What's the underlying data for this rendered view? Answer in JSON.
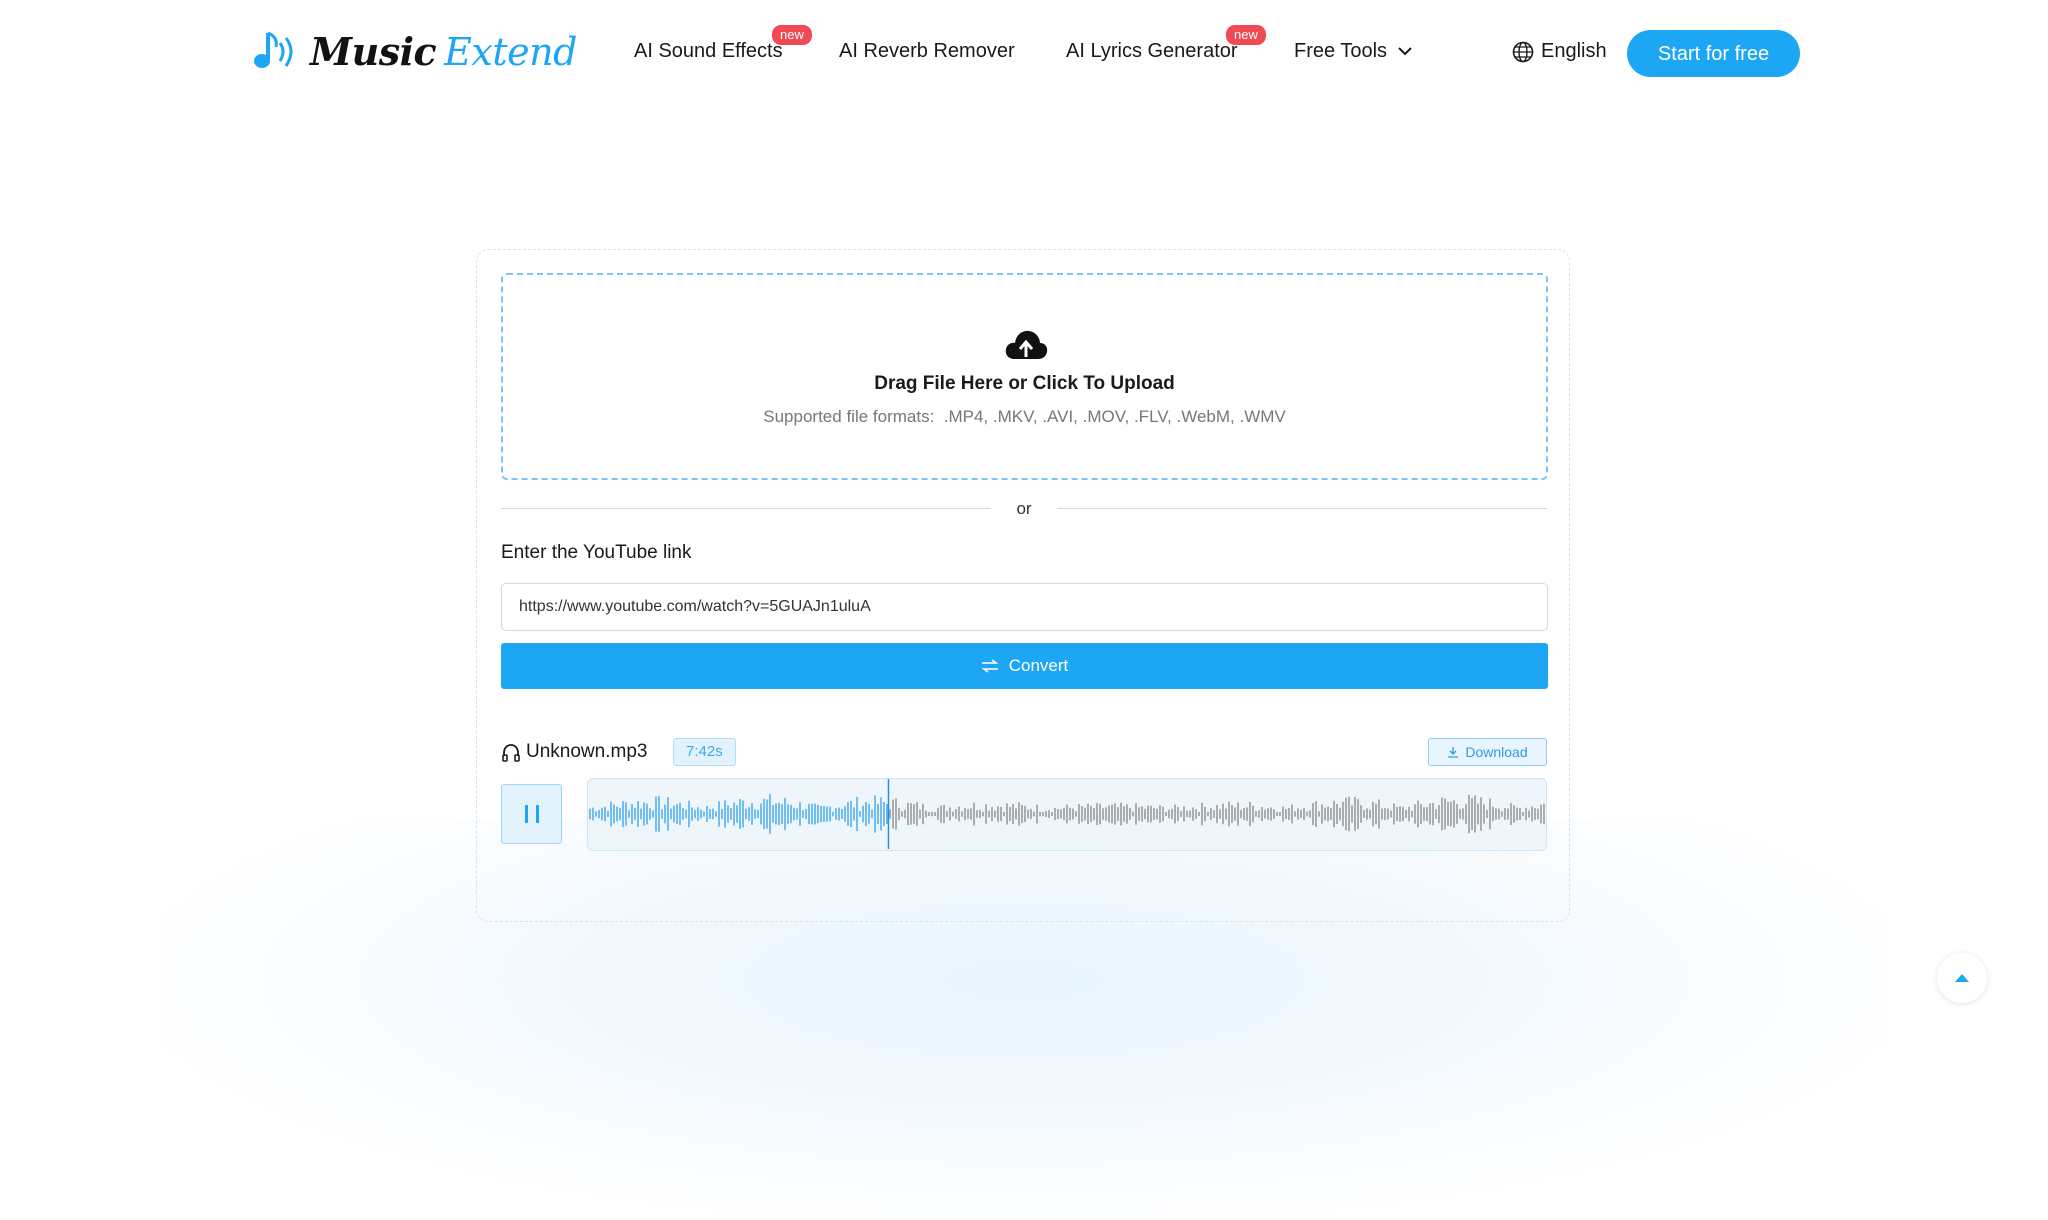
{
  "brand": {
    "name_part1": "Music",
    "name_part2": "Extend",
    "accent": "#1da6f4"
  },
  "nav": {
    "items": [
      {
        "label": "AI Sound Effects",
        "badge": "new"
      },
      {
        "label": "AI Reverb Remover",
        "badge": ""
      },
      {
        "label": "AI Lyrics Generator",
        "badge": "new"
      },
      {
        "label": "Free Tools",
        "badge": ""
      }
    ],
    "language": "English",
    "cta": "Start for free"
  },
  "upload": {
    "title": "Drag File Here or Click To Upload",
    "formats_label": "Supported file formats:",
    "formats": ".MP4, .MKV, .AVI, .MOV, .FLV, .WebM, .WMV",
    "divider": "or"
  },
  "youtube": {
    "label": "Enter the YouTube link",
    "value": "https://www.youtube.com/watch?v=5GUAJn1uluA",
    "convert_label": "Convert"
  },
  "player": {
    "file_name": "Unknown.mp3",
    "duration": "7:42s",
    "download_label": "Download",
    "playback_progress": 0.313,
    "played_color": "#3aa7ee",
    "unplayed_color": "#8e8e8e"
  }
}
